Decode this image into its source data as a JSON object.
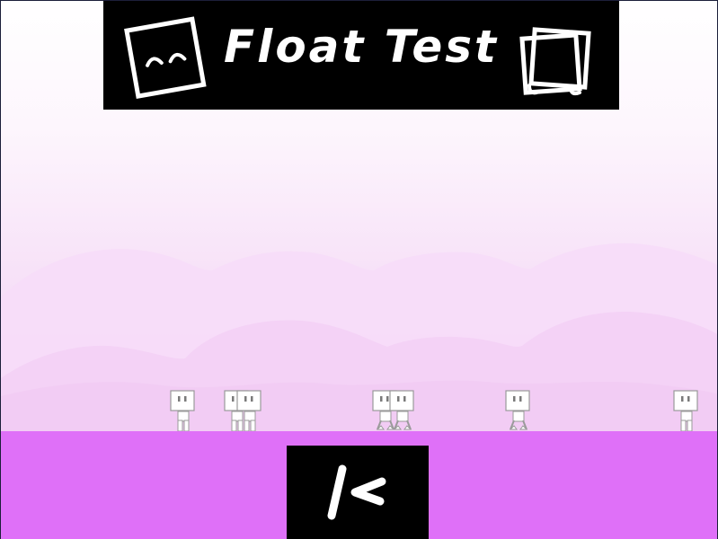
{
  "title": "Float Test",
  "icons": {
    "left": "smiling-box-icon",
    "right": "stacked-pages-icon",
    "action": "resume-icon"
  },
  "colors": {
    "ground": "#df70f8",
    "banner": "#000000",
    "sky_top": "#ffffff",
    "hills": "#f3d2f5",
    "robot_body": "#ffffff",
    "robot_outline": "#9a9a9a"
  },
  "characters": [
    {
      "name": "robot-1"
    },
    {
      "name": "robot-2"
    },
    {
      "name": "robot-3"
    },
    {
      "name": "robot-4"
    },
    {
      "name": "robot-5"
    },
    {
      "name": "robot-6"
    },
    {
      "name": "robot-7"
    }
  ]
}
